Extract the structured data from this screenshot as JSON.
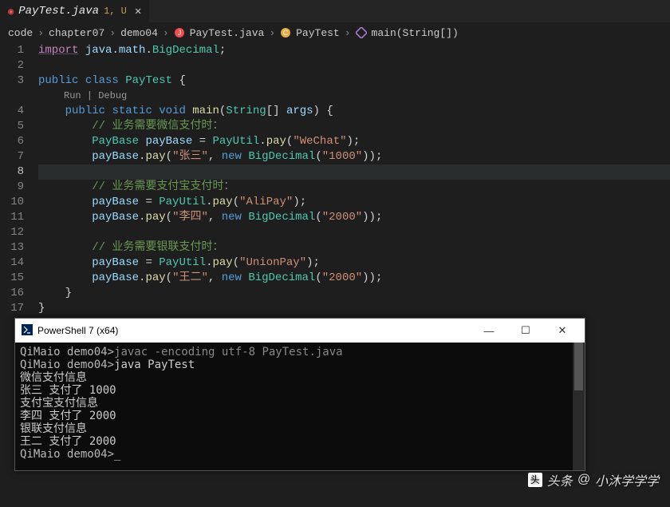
{
  "tab": {
    "filename": "PayTest.java",
    "status": "1, U"
  },
  "breadcrumbs": {
    "items": [
      "code",
      "chapter07",
      "demo04",
      "PayTest.java",
      "PayTest",
      "main(String[])"
    ]
  },
  "codelens": {
    "run": "Run",
    "debug": "Debug"
  },
  "active_line": 8,
  "code": {
    "lines": [
      {
        "n": 1,
        "t": [
          [
            "imp",
            "import"
          ],
          [
            "pn",
            " "
          ],
          [
            "var",
            "java"
          ],
          [
            "pn",
            "."
          ],
          [
            "var",
            "math"
          ],
          [
            "pn",
            "."
          ],
          [
            "cls",
            "BigDecimal"
          ],
          [
            "pn",
            ";"
          ]
        ]
      },
      {
        "n": 2,
        "t": []
      },
      {
        "n": 3,
        "t": [
          [
            "kw",
            "public"
          ],
          [
            "pn",
            " "
          ],
          [
            "kw",
            "class"
          ],
          [
            "pn",
            " "
          ],
          [
            "cls",
            "PayTest"
          ],
          [
            "pn",
            " {"
          ]
        ]
      },
      {
        "n": 4,
        "indent": 1,
        "t": [
          [
            "kw",
            "public"
          ],
          [
            "pn",
            " "
          ],
          [
            "kw",
            "static"
          ],
          [
            "pn",
            " "
          ],
          [
            "kw",
            "void"
          ],
          [
            "pn",
            " "
          ],
          [
            "fn",
            "main"
          ],
          [
            "pn",
            "("
          ],
          [
            "cls",
            "String"
          ],
          [
            "pn",
            "[] "
          ],
          [
            "var",
            "args"
          ],
          [
            "pn",
            ") {"
          ]
        ]
      },
      {
        "n": 5,
        "indent": 2,
        "t": [
          [
            "cmt",
            "// 业务需要微信支付时："
          ]
        ]
      },
      {
        "n": 6,
        "indent": 2,
        "t": [
          [
            "cls",
            "PayBase"
          ],
          [
            "pn",
            " "
          ],
          [
            "var",
            "payBase"
          ],
          [
            "pn",
            " "
          ],
          [
            "op",
            "="
          ],
          [
            "pn",
            " "
          ],
          [
            "cls",
            "PayUtil"
          ],
          [
            "pn",
            "."
          ],
          [
            "fn",
            "pay"
          ],
          [
            "pn",
            "("
          ],
          [
            "str",
            "\"WeChat\""
          ],
          [
            "pn",
            ");"
          ]
        ]
      },
      {
        "n": 7,
        "indent": 2,
        "t": [
          [
            "var",
            "payBase"
          ],
          [
            "pn",
            "."
          ],
          [
            "fn",
            "pay"
          ],
          [
            "pn",
            "("
          ],
          [
            "str",
            "\"张三\""
          ],
          [
            "pn",
            ", "
          ],
          [
            "kw",
            "new"
          ],
          [
            "pn",
            " "
          ],
          [
            "cls",
            "BigDecimal"
          ],
          [
            "pn",
            "("
          ],
          [
            "str",
            "\"1000\""
          ],
          [
            "pn",
            "));"
          ]
        ]
      },
      {
        "n": 8,
        "indent": 0,
        "t": []
      },
      {
        "n": 9,
        "indent": 2,
        "t": [
          [
            "cmt",
            "// 业务需要支付宝支付时："
          ]
        ]
      },
      {
        "n": 10,
        "indent": 2,
        "t": [
          [
            "var",
            "payBase"
          ],
          [
            "pn",
            " "
          ],
          [
            "op",
            "="
          ],
          [
            "pn",
            " "
          ],
          [
            "cls",
            "PayUtil"
          ],
          [
            "pn",
            "."
          ],
          [
            "fn",
            "pay"
          ],
          [
            "pn",
            "("
          ],
          [
            "str",
            "\"AliPay\""
          ],
          [
            "pn",
            ");"
          ]
        ]
      },
      {
        "n": 11,
        "indent": 2,
        "t": [
          [
            "var",
            "payBase"
          ],
          [
            "pn",
            "."
          ],
          [
            "fn",
            "pay"
          ],
          [
            "pn",
            "("
          ],
          [
            "str",
            "\"李四\""
          ],
          [
            "pn",
            ", "
          ],
          [
            "kw",
            "new"
          ],
          [
            "pn",
            " "
          ],
          [
            "cls",
            "BigDecimal"
          ],
          [
            "pn",
            "("
          ],
          [
            "str",
            "\"2000\""
          ],
          [
            "pn",
            "));"
          ]
        ]
      },
      {
        "n": 12,
        "indent": 0,
        "t": []
      },
      {
        "n": 13,
        "indent": 2,
        "t": [
          [
            "cmt",
            "// 业务需要银联支付时："
          ]
        ]
      },
      {
        "n": 14,
        "indent": 2,
        "t": [
          [
            "var",
            "payBase"
          ],
          [
            "pn",
            " "
          ],
          [
            "op",
            "="
          ],
          [
            "pn",
            " "
          ],
          [
            "cls",
            "PayUtil"
          ],
          [
            "pn",
            "."
          ],
          [
            "fn",
            "pay"
          ],
          [
            "pn",
            "("
          ],
          [
            "str",
            "\"UnionPay\""
          ],
          [
            "pn",
            ");"
          ]
        ]
      },
      {
        "n": 15,
        "indent": 2,
        "t": [
          [
            "var",
            "payBase"
          ],
          [
            "pn",
            "."
          ],
          [
            "fn",
            "pay"
          ],
          [
            "pn",
            "("
          ],
          [
            "str",
            "\"王二\""
          ],
          [
            "pn",
            ", "
          ],
          [
            "kw",
            "new"
          ],
          [
            "pn",
            " "
          ],
          [
            "cls",
            "BigDecimal"
          ],
          [
            "pn",
            "("
          ],
          [
            "str",
            "\"2000\""
          ],
          [
            "pn",
            "));"
          ]
        ]
      },
      {
        "n": 16,
        "indent": 1,
        "t": [
          [
            "pn",
            "}"
          ]
        ]
      },
      {
        "n": 17,
        "indent": 0,
        "t": [
          [
            "pn",
            "}"
          ]
        ]
      }
    ]
  },
  "terminal": {
    "title": "PowerShell 7 (x64)",
    "lines": [
      {
        "segs": [
          [
            "prompt",
            "QiMaio demo04>"
          ],
          [
            "cmd-faint",
            "javac -encoding utf-8 PayTest.java"
          ]
        ]
      },
      {
        "segs": [
          [
            "prompt",
            "QiMaio demo04>"
          ],
          [
            "",
            "java PayTest"
          ]
        ]
      },
      {
        "segs": [
          [
            "",
            "微信支付信息"
          ]
        ]
      },
      {
        "segs": [
          [
            "",
            "张三 支付了 1000"
          ]
        ]
      },
      {
        "segs": [
          [
            "",
            "支付宝支付信息"
          ]
        ]
      },
      {
        "segs": [
          [
            "",
            "李四 支付了 2000"
          ]
        ]
      },
      {
        "segs": [
          [
            "",
            "银联支付信息"
          ]
        ]
      },
      {
        "segs": [
          [
            "",
            "王二 支付了 2000"
          ]
        ]
      },
      {
        "segs": [
          [
            "prompt",
            "QiMaio demo04>"
          ],
          [
            "",
            "_"
          ]
        ]
      }
    ]
  },
  "watermark": {
    "prefix": "头条",
    "at": "@",
    "name": "小沐学学学"
  }
}
